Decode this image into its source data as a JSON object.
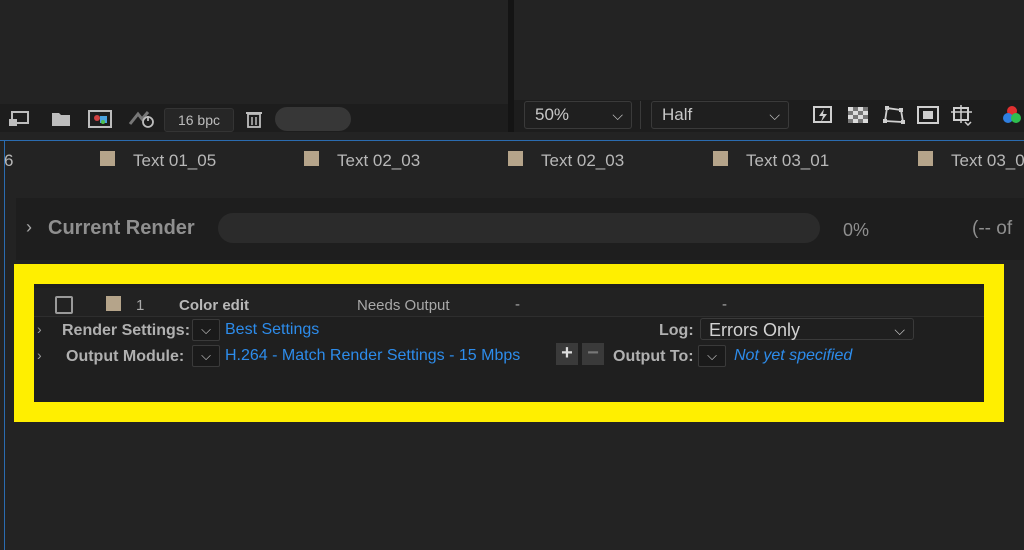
{
  "project_toolbar": {
    "bpc": "16 bpc",
    "icons": [
      "interpret-footage-icon",
      "new-folder-icon",
      "new-composition-icon",
      "flowchart-icon",
      "trash-icon"
    ]
  },
  "viewer_toolbar": {
    "zoom": "50%",
    "resolution": "Half",
    "icons": [
      "fast-previews-icon",
      "transparency-grid-icon",
      "mask-path-icon",
      "region-of-interest-icon",
      "guides-grid-icon",
      "channels-icon"
    ]
  },
  "comp_tabs": {
    "partial_first": "6",
    "items": [
      {
        "label": "Text 01_05"
      },
      {
        "label": "Text 02_03"
      },
      {
        "label": "Text 02_03"
      },
      {
        "label": "Text 03_01"
      },
      {
        "label": "Text 03_0"
      }
    ]
  },
  "render_queue": {
    "current_render_label": "Current Render",
    "progress_percent": "0%",
    "progress_fraction": 0,
    "progress_of": "(-- of",
    "item": {
      "number": "1",
      "comp_name": "Color edit",
      "status": "Needs Output",
      "started": "-",
      "render_time": "-",
      "render_settings_label": "Render Settings:",
      "render_settings_value": "Best Settings",
      "log_label": "Log:",
      "log_value": "Errors Only",
      "output_module_label": "Output Module:",
      "output_module_value": "H.264 - Match Render Settings - 15 Mbps",
      "output_to_label": "Output To:",
      "output_to_value": "Not yet specified"
    }
  },
  "colors": {
    "highlight": "#ffef00",
    "link": "#2d8ceb",
    "label_swatch": "#b5a48a",
    "panel_accent": "#2b6cb0"
  }
}
